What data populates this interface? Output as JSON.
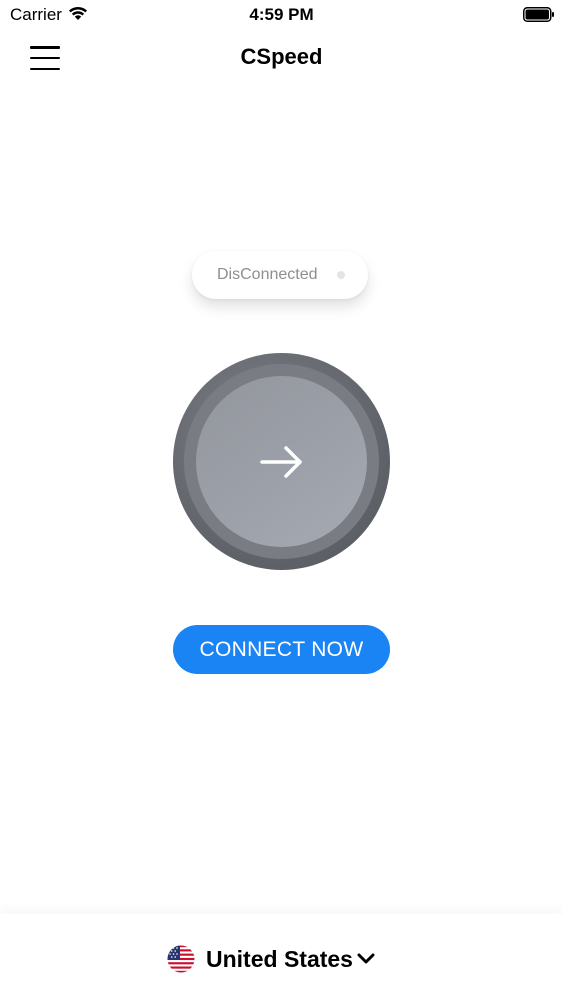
{
  "status_bar": {
    "carrier": "Carrier",
    "time": "4:59 PM",
    "icons": [
      "wifi-icon",
      "battery-icon"
    ]
  },
  "nav": {
    "title": "CSpeed",
    "menu_icon": "hamburger-menu-icon"
  },
  "connection": {
    "status_text": "DisConnected",
    "status_dot_color": "#e4e4e8",
    "power_icon": "arrow-right-icon"
  },
  "connect_button": {
    "label": "CONNECT NOW",
    "color": "#1a84f5"
  },
  "location": {
    "country": "United States",
    "flag_icon": "us-flag-icon",
    "dropdown_icon": "chevron-down-icon"
  }
}
